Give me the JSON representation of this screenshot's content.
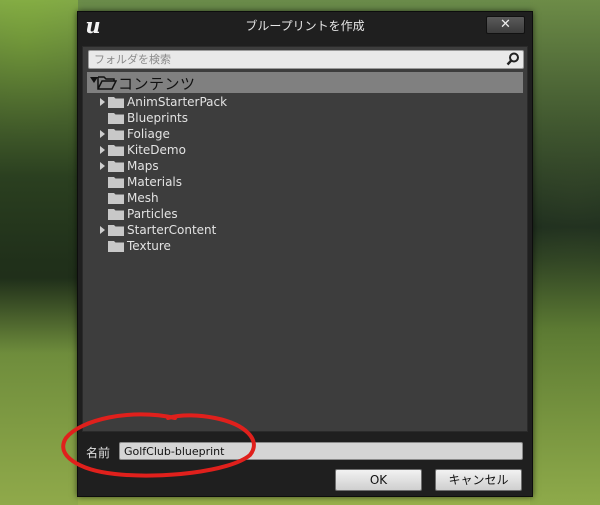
{
  "window": {
    "title": "ブループリントを作成",
    "close_label": "✕"
  },
  "search": {
    "placeholder": "フォルダを検索",
    "value": ""
  },
  "tree": {
    "root_label": "コンテンツ",
    "items": [
      {
        "label": "AnimStarterPack",
        "expandable": true
      },
      {
        "label": "Blueprints",
        "expandable": false
      },
      {
        "label": "Foliage",
        "expandable": true
      },
      {
        "label": "KiteDemo",
        "expandable": true
      },
      {
        "label": "Maps",
        "expandable": true
      },
      {
        "label": "Materials",
        "expandable": false
      },
      {
        "label": "Mesh",
        "expandable": false
      },
      {
        "label": "Particles",
        "expandable": false
      },
      {
        "label": "StarterContent",
        "expandable": true
      },
      {
        "label": "Texture",
        "expandable": false
      }
    ]
  },
  "name_field": {
    "label": "名前",
    "value": "GolfClub-blueprint"
  },
  "buttons": {
    "ok_label": "OK",
    "cancel_label": "キャンセル"
  },
  "colors": {
    "annotation": "#e0201c",
    "folder": "#c8c8c8",
    "selected_row": "#808080"
  }
}
